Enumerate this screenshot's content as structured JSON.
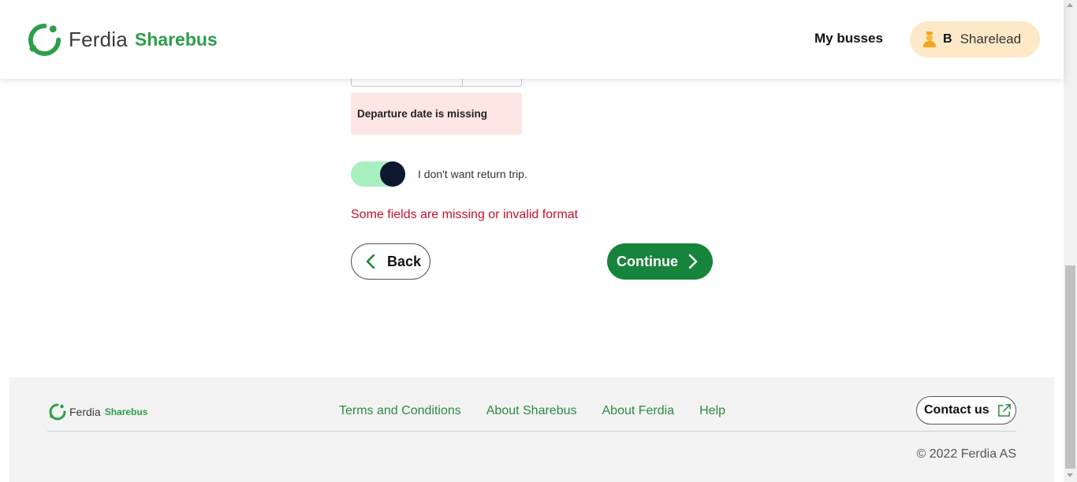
{
  "brand": {
    "name_part1": "Ferdia",
    "name_part2": "Sharebus",
    "logo_icon": "ferdia-ring-logo"
  },
  "header": {
    "nav_busses": "My busses",
    "user": {
      "initial": "B",
      "name": "Sharelead",
      "icon": "user-badge-icon"
    }
  },
  "form": {
    "date_error": "Departure date is missing",
    "return_toggle": {
      "label": "I don't want return trip.",
      "checked": true
    },
    "error_message": "Some fields are missing or invalid format",
    "back_label": "Back",
    "continue_label": "Continue"
  },
  "footer": {
    "links": [
      "Terms and Conditions",
      "About Sharebus",
      "About Ferdia",
      "Help"
    ],
    "contact_label": "Contact us",
    "copyright": "© 2022 Ferdia AS"
  },
  "colors": {
    "brand_green": "#2e9e4a",
    "button_green": "#17843b",
    "error_red": "#c4122f",
    "error_bg": "#fde6e3",
    "toggle_track": "#a8efc2",
    "toggle_knob": "#0f1730",
    "user_pill_bg": "#fde9c8"
  }
}
